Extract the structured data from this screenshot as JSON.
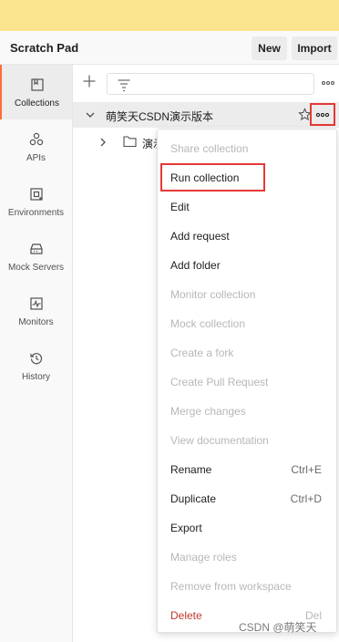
{
  "header": {
    "workspace_title": "Scratch Pad",
    "new_label": "New",
    "import_label": "Import"
  },
  "sidebar": {
    "items": [
      {
        "label": "Collections",
        "icon": "collections-icon",
        "active": true
      },
      {
        "label": "APIs",
        "icon": "apis-icon"
      },
      {
        "label": "Environments",
        "icon": "environments-icon"
      },
      {
        "label": "Mock Servers",
        "icon": "mock-servers-icon"
      },
      {
        "label": "Monitors",
        "icon": "monitors-icon"
      },
      {
        "label": "History",
        "icon": "history-icon"
      }
    ]
  },
  "collection": {
    "name": "萌笑天CSDN演示版本",
    "folder_name": "演示"
  },
  "context_menu": {
    "items": [
      {
        "label": "Share collection",
        "disabled": true
      },
      {
        "label": "Run collection",
        "highlighted": true
      },
      {
        "label": "Edit"
      },
      {
        "label": "Add request"
      },
      {
        "label": "Add folder"
      },
      {
        "label": "Monitor collection",
        "disabled": true
      },
      {
        "label": "Mock collection",
        "disabled": true
      },
      {
        "label": "Create a fork",
        "disabled": true
      },
      {
        "label": "Create Pull Request",
        "disabled": true
      },
      {
        "label": "Merge changes",
        "disabled": true
      },
      {
        "label": "View documentation",
        "disabled": true
      },
      {
        "label": "Rename",
        "shortcut": "Ctrl+E"
      },
      {
        "label": "Duplicate",
        "shortcut": "Ctrl+D"
      },
      {
        "label": "Export"
      },
      {
        "label": "Manage roles",
        "disabled": true
      },
      {
        "label": "Remove from workspace",
        "disabled": true
      },
      {
        "label": "Delete",
        "shortcut": "Del",
        "danger": true
      }
    ]
  },
  "watermark": "CSDN @萌笑天",
  "colors": {
    "banner": "#fbe48e",
    "accent": "#ff6c37",
    "highlight_box": "#e53935",
    "danger_text": "#c0392b"
  }
}
